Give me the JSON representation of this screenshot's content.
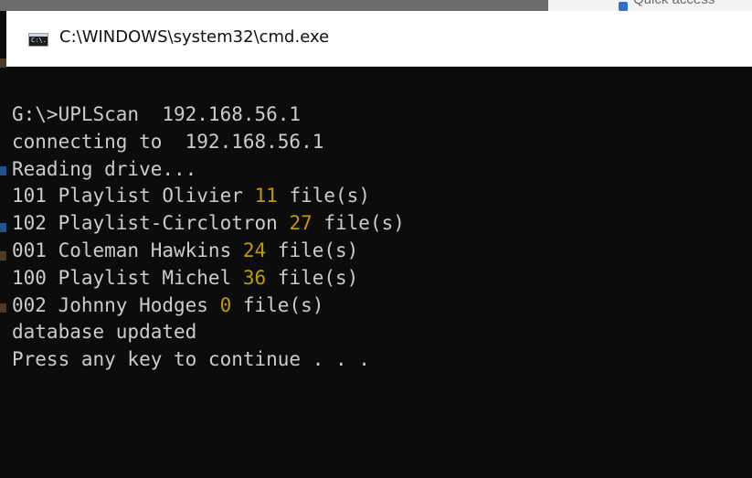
{
  "background_window": {
    "partial_label": "Quick access"
  },
  "window": {
    "title": "C:\\WINDOWS\\system32\\cmd.exe",
    "icon_text": "C:\\."
  },
  "console": {
    "text_color": "#cccccc",
    "highlight_color": "#c19c00",
    "background_color": "#0c0c0c",
    "lines": [
      {
        "text": "G:\\>UPLScan  192.168.56.1"
      },
      {
        "text": "connecting to  192.168.56.1"
      },
      {
        "text": "Reading drive..."
      },
      {
        "prefix": "101 Playlist Olivier ",
        "count": "11",
        "suffix": " file(s)"
      },
      {
        "prefix": "102 Playlist-Circlotron ",
        "count": "27",
        "suffix": " file(s)"
      },
      {
        "prefix": "001 Coleman Hawkins ",
        "count": "24",
        "suffix": " file(s)"
      },
      {
        "prefix": "100 Playlist Michel ",
        "count": "36",
        "suffix": " file(s)"
      },
      {
        "prefix": "002 Johnny Hodges ",
        "count": "0",
        "suffix": " file(s)"
      },
      {
        "text": "database updated"
      },
      {
        "text": "Press any key to continue . . ."
      }
    ]
  }
}
